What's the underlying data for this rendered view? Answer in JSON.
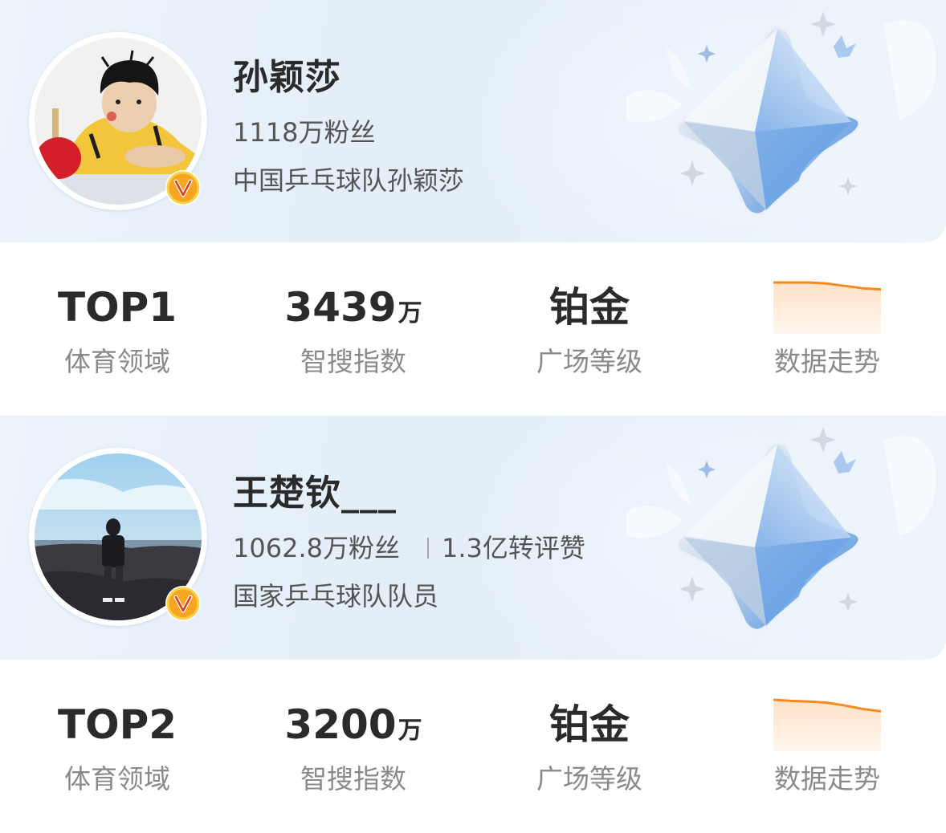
{
  "cards": [
    {
      "name": "孙颖莎",
      "fans": "1118万粉丝",
      "engagement": "",
      "description": "中国乒乓球队孙颖莎",
      "verified_icon": "orange-v-badge-icon",
      "stats": {
        "rank": "TOP1",
        "rank_label": "体育领域",
        "index_value": "3439",
        "index_unit": "万",
        "index_label": "智搜指数",
        "level_value": "铂金",
        "level_label": "广场等级",
        "trend_label": "数据走势"
      },
      "trend_data": [
        1.0,
        1.0,
        1.0,
        0.98,
        0.94,
        0.9,
        0.88
      ]
    },
    {
      "name": "王楚钦___",
      "fans": "1062.8万粉丝",
      "engagement": "1.3亿转评赞",
      "description": "国家乒乓球队队员",
      "verified_icon": "orange-v-badge-icon",
      "stats": {
        "rank": "TOP2",
        "rank_label": "体育领域",
        "index_value": "3200",
        "index_unit": "万",
        "index_label": "智搜指数",
        "level_value": "铂金",
        "level_label": "广场等级",
        "trend_label": "数据走势"
      },
      "trend_data": [
        1.0,
        0.98,
        0.97,
        0.95,
        0.9,
        0.84,
        0.8
      ]
    }
  ],
  "colors": {
    "accent": "#f58a1f",
    "trend_fill_top": "#fde2c8",
    "badge": "#f6a623"
  }
}
